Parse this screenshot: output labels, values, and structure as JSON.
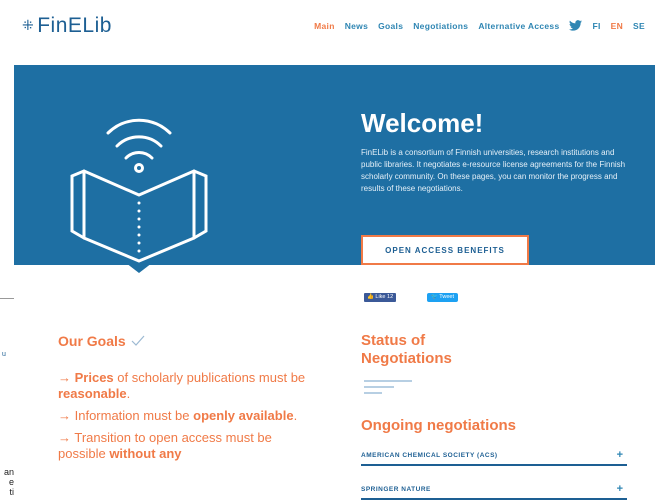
{
  "background_window": {
    "fragment_1": "u",
    "fragment_2": [
      "an",
      "e",
      "ti"
    ]
  },
  "header": {
    "logo_text": "FinELib",
    "nav": [
      "Main",
      "News",
      "Goals",
      "Negotiations",
      "Alternative Access"
    ],
    "languages": [
      "FI",
      "EN",
      "SE"
    ],
    "active_nav": "Main",
    "active_language": "EN"
  },
  "hero": {
    "title": "Welcome!",
    "text": "FinELib is a consortium of Finnish universities, research institutions and public libraries. It negotiates e-resource license agreements for the Finnish scholarly community. On these pages, you can monitor the progress and results of these negotiations.",
    "button_label": "OPEN ACCESS BENEFITS"
  },
  "social": {
    "like_label": "Like 12",
    "tweet_label": "Tweet"
  },
  "goals": {
    "title": "Our Goals",
    "items": [
      {
        "pre": "→ ",
        "bold1": "Prices",
        "mid": " of scholarly publications must be ",
        "bold2": "reasonable",
        "post": "."
      },
      {
        "pre": "→ Information must be ",
        "bold1": "openly available",
        "mid": ".",
        "bold2": "",
        "post": ""
      },
      {
        "pre": "→ Transition to open access must be possible ",
        "bold1": "without any",
        "mid": "",
        "bold2": "",
        "post": ""
      }
    ]
  },
  "status": {
    "title": "Status of Negotiations",
    "ongoing_title": "Ongoing negotiations",
    "items": [
      "AMERICAN CHEMICAL SOCIETY (ACS)",
      "SPRINGER NATURE"
    ]
  },
  "colors": {
    "primary": "#1e6fa3",
    "accent": "#f07a47",
    "link": "#2f86b3"
  }
}
